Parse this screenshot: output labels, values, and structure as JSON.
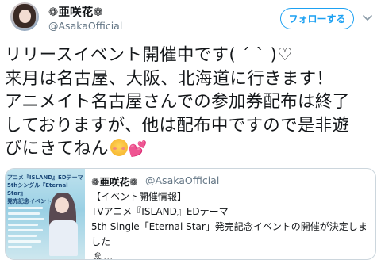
{
  "author": {
    "name": "❁亜咲花❁",
    "handle": "@AsakaOfficial"
  },
  "follow_button": {
    "label": "フォローする"
  },
  "tweet": {
    "text": "リリースイベント開催中です( ˊ ˋ )♡\n来月は名古屋、大阪、北海道に行きます！\nアニメイト名古屋さんでの参加券配布は終了\nしておりますが、他は配布中ですので是非遊\nびにきてねん"
  },
  "quoted_tweet": {
    "name": "❁亜咲花❁",
    "handle": "@AsakaOfficial",
    "text": "【イベント開催情報】\nTVアニメ『ISLAND』EDテーマ\n5th Single「Eternal Star」発売記念イベントの開催が決定しました\n",
    "thumbnail_caption": "アニメ『ISLAND』EDテーマ\n5thシングル『Eternal Star』\n発売記念イベント",
    "trailing_emoji": "island-emoji",
    "ellipsis": "…"
  },
  "icons": [
    "avatar",
    "follow-button",
    "chevron-down-icon",
    "smiling-face-emoji",
    "two-hearts-emoji",
    "desert-island-emoji"
  ]
}
